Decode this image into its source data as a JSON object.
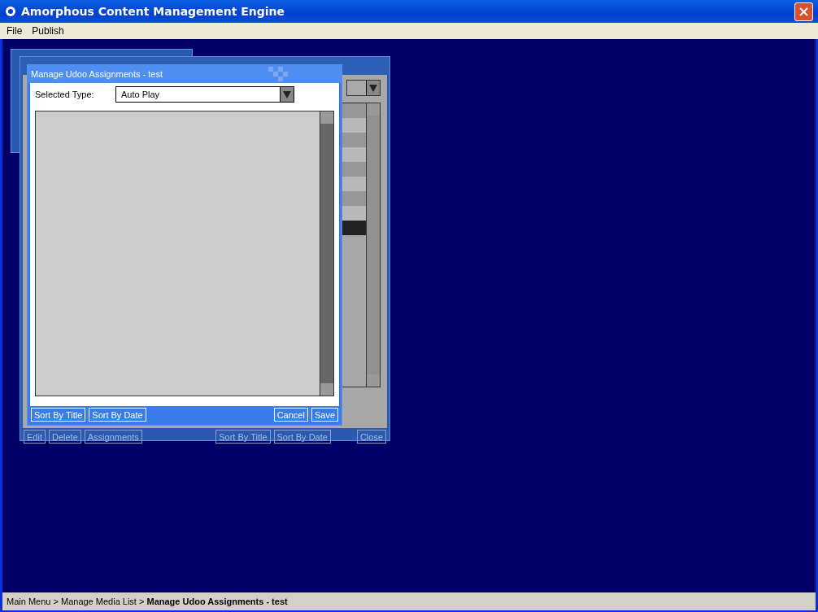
{
  "window": {
    "title": "Amorphous Content Management Engine"
  },
  "menu": [
    "File",
    "Publish"
  ],
  "media_list_window": {
    "active": false,
    "rows": [
      {
        "selected": false
      },
      {
        "selected": false
      },
      {
        "selected": false
      },
      {
        "selected": false
      },
      {
        "selected": false
      },
      {
        "selected": false
      },
      {
        "selected": false
      },
      {
        "selected": false
      },
      {
        "selected": true
      }
    ],
    "left_buttons": [
      "Edit",
      "Delete",
      "Assignments"
    ],
    "right_buttons": [
      "Sort By Title",
      "Sort By Date"
    ],
    "close_button": "Close"
  },
  "dialog": {
    "title": "Manage Udoo Assignments - test",
    "active": true,
    "type_label": "Selected Type:",
    "type_value": "Auto Play",
    "left_buttons": [
      "Sort By Title",
      "Sort By Date"
    ],
    "right_buttons": [
      "Cancel",
      "Save"
    ]
  },
  "breadcrumb": {
    "parents": [
      "Main Menu",
      "Manage Media List"
    ],
    "separator": ">",
    "current": "Manage Udoo Assignments - test"
  }
}
